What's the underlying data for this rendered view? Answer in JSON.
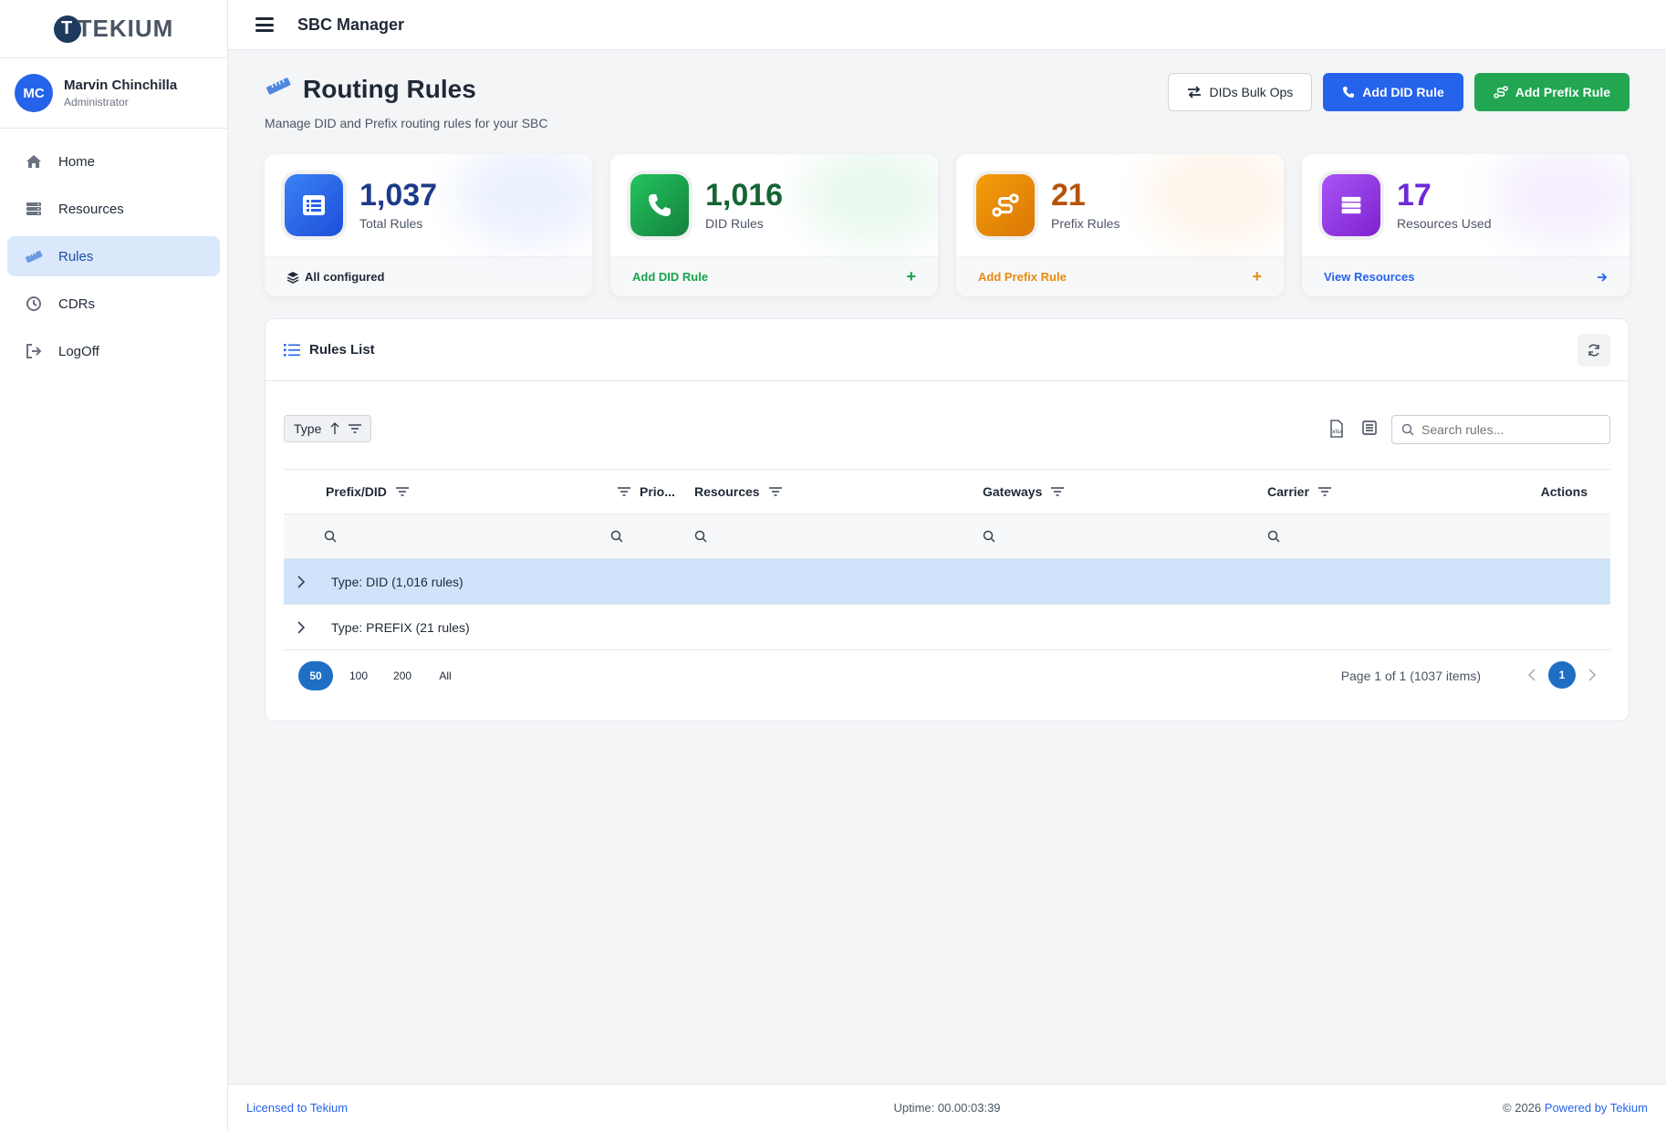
{
  "brand": {
    "logo_text": "TEKIUM",
    "logo_letter": "T"
  },
  "user": {
    "initials": "MC",
    "name": "Marvin Chinchilla",
    "role": "Administrator"
  },
  "nav": [
    {
      "label": "Home",
      "icon": "home-icon",
      "active": false
    },
    {
      "label": "Resources",
      "icon": "server-icon",
      "active": false
    },
    {
      "label": "Rules",
      "icon": "ruler-icon",
      "active": true
    },
    {
      "label": "CDRs",
      "icon": "history-icon",
      "active": false
    },
    {
      "label": "LogOff",
      "icon": "logout-icon",
      "active": false
    }
  ],
  "topbar": {
    "title": "SBC Manager"
  },
  "page": {
    "title": "Routing Rules",
    "subtitle": "Manage DID and Prefix routing rules for your SBC",
    "buttons": {
      "bulk": "DIDs Bulk Ops",
      "add_did": "Add DID Rule",
      "add_prefix": "Add Prefix Rule"
    }
  },
  "stats": [
    {
      "value": "1,037",
      "label": "Total Rules",
      "footer": "All configured",
      "color": "#2563eb",
      "icon": "list-icon"
    },
    {
      "value": "1,016",
      "label": "DID Rules",
      "footer": "Add DID Rule",
      "color": "#16a34a",
      "icon": "phone-icon"
    },
    {
      "value": "21",
      "label": "Prefix Rules",
      "footer": "Add Prefix Rule",
      "color": "#ea8a0c",
      "icon": "route-icon"
    },
    {
      "value": "17",
      "label": "Resources Used",
      "footer": "View Resources",
      "color": "#8b3ee6",
      "icon": "server-icon"
    }
  ],
  "panel": {
    "title": "Rules List",
    "group_chip": "Type",
    "search_placeholder": "Search rules...",
    "columns": [
      "Prefix/DID",
      "Prio...",
      "Resources",
      "Gateways",
      "Carrier",
      "Actions"
    ],
    "groups": [
      {
        "label": "Type: DID (1,016 rules)",
        "selected": true
      },
      {
        "label": "Type: PREFIX (21 rules)",
        "selected": false
      }
    ],
    "page_sizes": [
      "50",
      "100",
      "200",
      "All"
    ],
    "active_page_size": "50",
    "page_info": "Page 1 of 1 (1037 items)",
    "current_page": "1"
  },
  "footer": {
    "left": "Licensed to Tekium",
    "center": "Uptime: 00.00:03:39",
    "right_prefix": "© 2026",
    "right_link": "Powered by Tekium"
  }
}
